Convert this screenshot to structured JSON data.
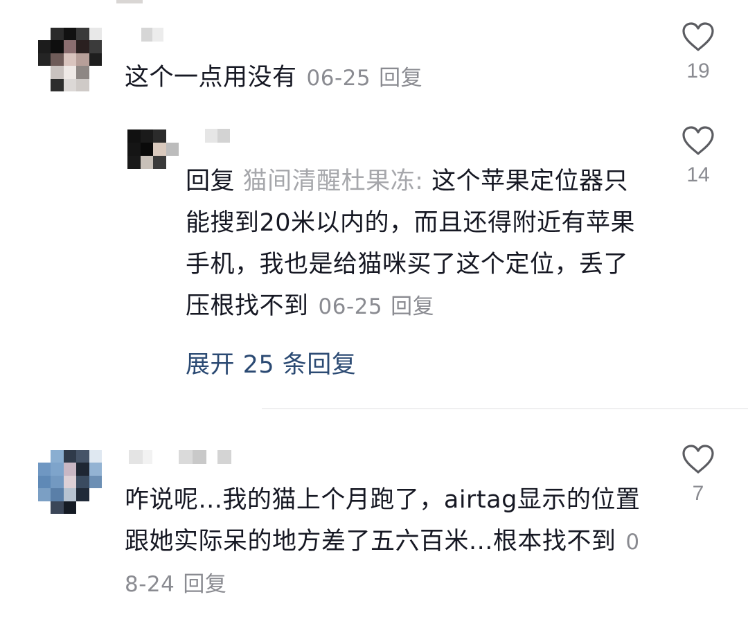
{
  "comments": [
    {
      "text": "这个一点用没有",
      "date": "06-25",
      "reply_label": "回复",
      "likes": "19"
    },
    {
      "reply_prefix": "回复",
      "reply_target": "猫间清醒杜果冻:",
      "text": "这个苹果定位器只能搜到20米以内的，而且还得附近有苹果手机，我也是给猫咪买了这个定位，丢了压根找不到",
      "date": "06-25",
      "reply_label": "回复",
      "likes": "14"
    },
    {
      "text": "咋说呢...我的猫上个月跑了，airtag显示的位置跟她实际呆的地方差了五六百米...根本找不到",
      "date": "08-24",
      "reply_label": "回复",
      "likes": "7"
    }
  ],
  "expand_replies": "展开 25 条回复",
  "icons": {
    "like": "heart-outline-icon"
  },
  "colors": {
    "text": "#161823",
    "meta": "#8a8b91",
    "link": "#2b4a73",
    "icon": "#5b5c61"
  }
}
